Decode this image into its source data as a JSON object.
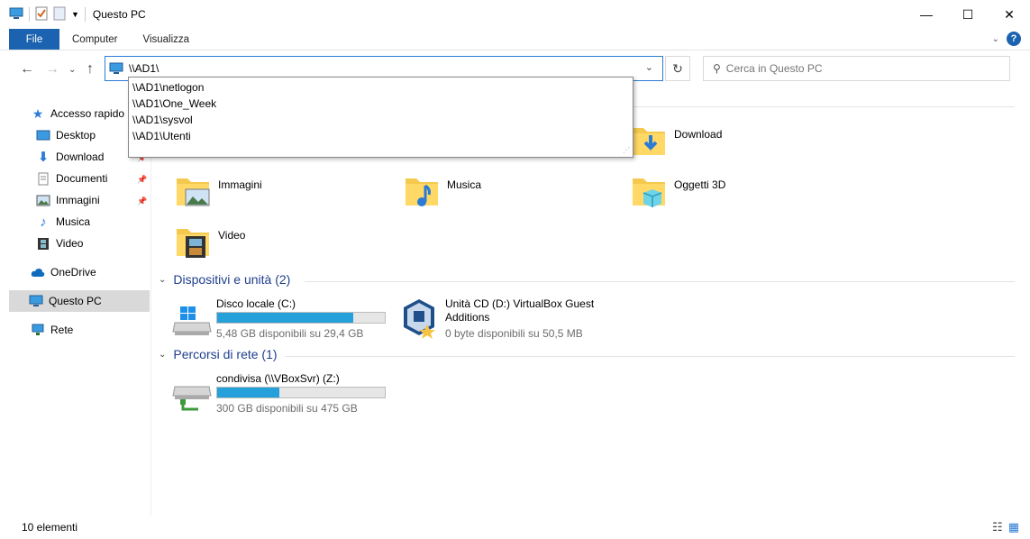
{
  "window": {
    "title": "Questo PC",
    "minimize": "—",
    "maximize": "☐",
    "close": "✕"
  },
  "ribbon": {
    "tabs": [
      "File",
      "Computer",
      "Visualizza"
    ],
    "help": "?"
  },
  "address": {
    "value": "\\\\AD1\\",
    "suggestions": [
      "\\\\AD1\\netlogon",
      "\\\\AD1\\One_Week",
      "\\\\AD1\\sysvol",
      "\\\\AD1\\Utenti"
    ]
  },
  "search": {
    "placeholder": "Cerca in Questo PC"
  },
  "sidebar": {
    "quick_access": "Accesso rapido",
    "items": [
      {
        "label": "Desktop",
        "pinned": true
      },
      {
        "label": "Download",
        "pinned": true
      },
      {
        "label": "Documenti",
        "pinned": true
      },
      {
        "label": "Immagini",
        "pinned": true
      },
      {
        "label": "Musica",
        "pinned": false
      },
      {
        "label": "Video",
        "pinned": false
      }
    ],
    "onedrive": "OneDrive",
    "this_pc": "Questo PC",
    "network": "Rete"
  },
  "folders": [
    {
      "name": "Download"
    },
    {
      "name": "Immagini"
    },
    {
      "name": "Musica"
    },
    {
      "name": "Oggetti 3D"
    },
    {
      "name": "Video"
    }
  ],
  "devices": {
    "heading": "Dispositivi e unità (2)",
    "items": [
      {
        "name": "Disco locale (C:)",
        "free": "5,48 GB disponibili su 29,4 GB",
        "used_fraction": 0.81
      },
      {
        "name": "Unità CD (D:) VirtualBox Guest",
        "name2": "Additions",
        "free": "0 byte disponibili su 50,5 MB"
      }
    ]
  },
  "network_locations": {
    "heading": "Percorsi di rete (1)",
    "items": [
      {
        "name": "condivisa (\\\\VBoxSvr) (Z:)",
        "free": "300 GB disponibili su 475 GB",
        "used_fraction": 0.37
      }
    ]
  },
  "status": {
    "count": "10 elementi"
  },
  "colors": {
    "accent": "#1b62b0",
    "bar_fill": "#26a0da",
    "heading": "#1e3e8c"
  }
}
